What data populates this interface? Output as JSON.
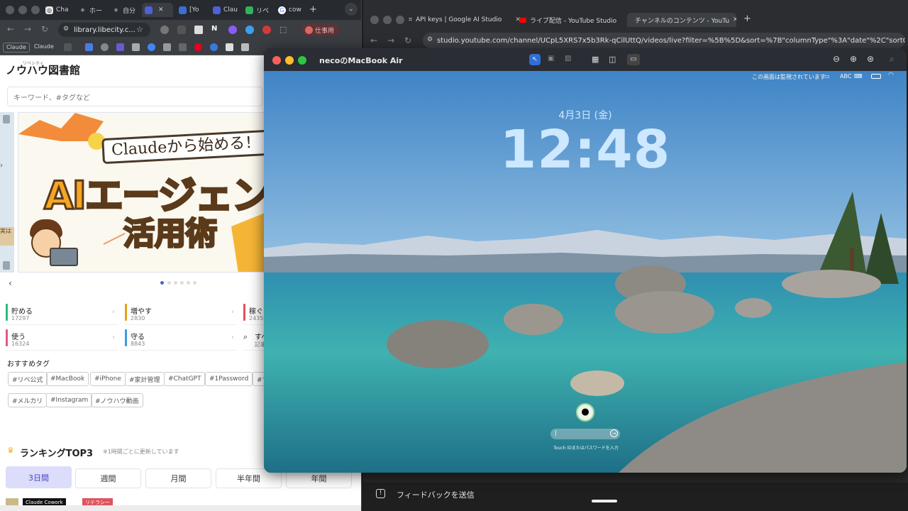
{
  "left_browser": {
    "tabs": [
      {
        "label": "Cha",
        "icon": "chatgpt-icon"
      },
      {
        "label": "ホー",
        "icon": "openai-icon"
      },
      {
        "label": "自分",
        "icon": "openai-icon"
      },
      {
        "label": "",
        "icon": "doc-icon"
      },
      {
        "label": "[Yo",
        "icon": "doc-icon"
      },
      {
        "label": "Clau",
        "icon": "doc-icon"
      },
      {
        "label": "リベ",
        "icon": "libecity-icon"
      },
      {
        "label": "cow",
        "icon": "google-icon"
      }
    ],
    "url": "library.libecity.c...",
    "profile_label": "仕事用",
    "bookmarks": [
      "Claude",
      "Claude"
    ],
    "page": {
      "logo": "ノウハウ図書館",
      "logo_sub": "リベシティ",
      "search_placeholder": "キーワード、#タグなど",
      "banner": {
        "pill": "Claudeから始める！",
        "line1": "AIエージェン",
        "line2": "活用術"
      },
      "categories": [
        {
          "name": "貯める",
          "count": "17297",
          "color": "#2dbd79"
        },
        {
          "name": "増やす",
          "count": "2830",
          "color": "#e3a21a"
        },
        {
          "name": "稼ぐ",
          "count": "2435",
          "color": "#e0525b"
        },
        {
          "name": "使う",
          "count": "16324",
          "color": "#e05a8a"
        },
        {
          "name": "守る",
          "count": "8843",
          "color": "#3d9be0"
        },
        {
          "name": "すべ",
          "count": "記事",
          "color": "#ffffff"
        }
      ],
      "tags_title": "おすすめタグ",
      "tags_row1": [
        "#リベ公式",
        "#MacBook",
        "#iPhone",
        "#家計管理",
        "#ChatGPT",
        "#1Password",
        "#マ"
      ],
      "tags_row2": [
        "#メルカリ",
        "#Instagram",
        "#ノウハウ動画"
      ],
      "ranking_title": "ランキングTOP3",
      "ranking_note": "※1時間ごとに更新しています",
      "ranking_tabs": [
        "3日間",
        "週間",
        "月間",
        "半年間",
        "年間"
      ],
      "bottom_badges": [
        "Claude Cowork",
        "リテラシー"
      ]
    }
  },
  "right_browser": {
    "tabs": [
      {
        "label": "API keys | Google AI Studio"
      },
      {
        "label": "ライブ配信 - YouTube Studio"
      },
      {
        "label": "チャンネルのコンテンツ - YouTu"
      }
    ],
    "url": "studio.youtube.com/channel/UCpL5XRS7x5b3Rk-qCilUttQ/videos/live?filter=%5B%5D&sort=%7B\"columnType\"%3A\"date\"%2C\"sortOrder\"%3A\"DESC",
    "feedback_label": "フィードバックを送信"
  },
  "screen_share": {
    "title": "necoのMacBook Air",
    "menubar_notice": "この画面は監視されています",
    "input_source": "ABC",
    "date": "4月3日 (金)",
    "time": "12:48",
    "password_hint": "Touch IDまたはパスワードを入力"
  }
}
